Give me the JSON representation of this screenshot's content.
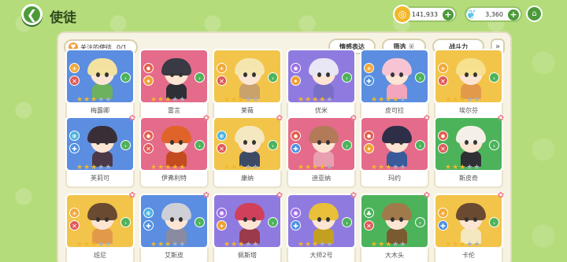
{
  "header": {
    "title": "使徒",
    "gold": "141,933",
    "gems": "3,360"
  },
  "filters": {
    "follow_label": "关注的使徒",
    "follow_count": "0/1",
    "emotion_label": "情感表达",
    "filter_label": "筛选",
    "filter_state": "关",
    "power_label": "战斗力"
  },
  "cards": [
    {
      "name": "梅露卿",
      "bg": "#5b8ee0",
      "hair": "#f3e2a0",
      "outfit": "#6db05e",
      "elem": "#f2a733",
      "elem_icon": "☀",
      "role": "#e05a5a",
      "role_icon": "✕",
      "arrow": "#4cb35a",
      "stars": 3
    },
    {
      "name": "雷言",
      "bg": "#e46b8a",
      "hair": "#3a3a44",
      "outfit": "#2f2f36",
      "elem": "#e25e4a",
      "elem_icon": "✹",
      "role": "#f0a030",
      "role_icon": "✦",
      "arrow": "#4cb35a",
      "stars": 3
    },
    {
      "name": "莱薇",
      "bg": "#f2c44a",
      "hair": "#f5e6b0",
      "outfit": "#c9a16a",
      "elem": "#f2a733",
      "elem_icon": "☀",
      "role": "#e05a5a",
      "role_icon": "✕",
      "arrow": "#4cb35a",
      "stars": 3
    },
    {
      "name": "优米",
      "bg": "#8f7be0",
      "hair": "#e9e6f5",
      "outfit": "#7a6fc7",
      "elem": "#9a6ae0",
      "elem_icon": "✺",
      "role": "#f0a030",
      "role_icon": "✦",
      "arrow": "#4cb35a",
      "stars": 4
    },
    {
      "name": "皮可拉",
      "bg": "#5b8ee0",
      "hair": "#f7c4d4",
      "outfit": "#f2a5bc",
      "elem": "#f2a733",
      "elem_icon": "☀",
      "role": "#4a90e2",
      "role_icon": "✚",
      "arrow": "#4cb35a",
      "stars": 4
    },
    {
      "name": "埃尔芬",
      "bg": "#f2c44a",
      "hair": "#f7e08e",
      "outfit": "#e29a4a",
      "elem": "#f2a733",
      "elem_icon": "☀",
      "role": "#e05a5a",
      "role_icon": "✕",
      "arrow": "#4cb35a",
      "stars": 3
    },
    {
      "name": "芙莉可",
      "bg": "#5b8ee0",
      "hair": "#3a2e36",
      "outfit": "#4b3848",
      "elem": "#49b3e0",
      "elem_icon": "❄",
      "role": "#4a90e2",
      "role_icon": "✚",
      "arrow": "#4cb35a",
      "stars": 3
    },
    {
      "name": "伊弗利特",
      "bg": "#e46b8a",
      "hair": "#e0632a",
      "outfit": "#c44a20",
      "elem": "#e25e4a",
      "elem_icon": "✹",
      "role": "#e05a5a",
      "role_icon": "✕",
      "arrow": "#4cb35a",
      "stars": 5
    },
    {
      "name": "康纳",
      "bg": "#f2c44a",
      "hair": "#f4e8c0",
      "outfit": "#3d4a66",
      "elem": "#49b3e0",
      "elem_icon": "❄",
      "role": "#e05a5a",
      "role_icon": "✕",
      "arrow": "#4cb35a",
      "stars": 3
    },
    {
      "name": "迪亚纳",
      "bg": "#e46b8a",
      "hair": "#b37a5a",
      "outfit": "#e8a0b0",
      "elem": "#e25e4a",
      "elem_icon": "✹",
      "role": "#4a90e2",
      "role_icon": "✚",
      "arrow": "#4cb35a",
      "stars": 4
    },
    {
      "name": "玛约",
      "bg": "#e46b8a",
      "hair": "#2e2e48",
      "outfit": "#3a5a9a",
      "elem": "#e25e4a",
      "elem_icon": "✹",
      "role": "#f0a030",
      "role_icon": "✦",
      "arrow": "#4cb35a",
      "stars": 3
    },
    {
      "name": "斯皮奇",
      "bg": "#4cb35a",
      "hair": "#f4f0e8",
      "outfit": "#2f2f36",
      "elem": "#e25e4a",
      "elem_icon": "✹",
      "role": "#e05a5a",
      "role_icon": "✕",
      "arrow": "#4cb35a",
      "stars": 3
    },
    {
      "name": "班尼",
      "bg": "#f2c44a",
      "hair": "#6a4a30",
      "outfit": "#e29a4a",
      "elem": "#f2a733",
      "elem_icon": "☀",
      "role": "#e05a5a",
      "role_icon": "✕",
      "arrow": "#4cb35a",
      "stars": 3
    },
    {
      "name": "艾斯皮",
      "bg": "#5b8ee0",
      "hair": "#cfcfd8",
      "outfit": "#8a8aa0",
      "elem": "#49b3e0",
      "elem_icon": "❄",
      "role": "#4a90e2",
      "role_icon": "✚",
      "arrow": "#4cb35a",
      "stars": 3
    },
    {
      "name": "佩斯塔",
      "bg": "#8f7be0",
      "hair": "#d0405a",
      "outfit": "#9a3a4a",
      "elem": "#9a6ae0",
      "elem_icon": "✺",
      "role": "#f0a030",
      "role_icon": "✦",
      "arrow": "#4cb35a",
      "stars": 3
    },
    {
      "name": "大师2号",
      "bg": "#8f7be0",
      "hair": "#e8c03a",
      "outfit": "#c4a020",
      "elem": "#9a6ae0",
      "elem_icon": "✺",
      "role": "#4a90e2",
      "role_icon": "✚",
      "arrow": "#4cb35a",
      "stars": 3
    },
    {
      "name": "大木头",
      "bg": "#4cb35a",
      "hair": "#a07a4a",
      "outfit": "#7a5a30",
      "elem": "#4cb35a",
      "elem_icon": "♣",
      "role": "#e05a5a",
      "role_icon": "✕",
      "arrow": "#4cb35a",
      "stars": 3
    },
    {
      "name": "卡伦",
      "bg": "#f2c44a",
      "hair": "#6a4a30",
      "outfit": "#f4e8c0",
      "elem": "#f2a733",
      "elem_icon": "☀",
      "role": "#4a90e2",
      "role_icon": "✚",
      "arrow": "#4cb35a",
      "stars": 3
    }
  ]
}
